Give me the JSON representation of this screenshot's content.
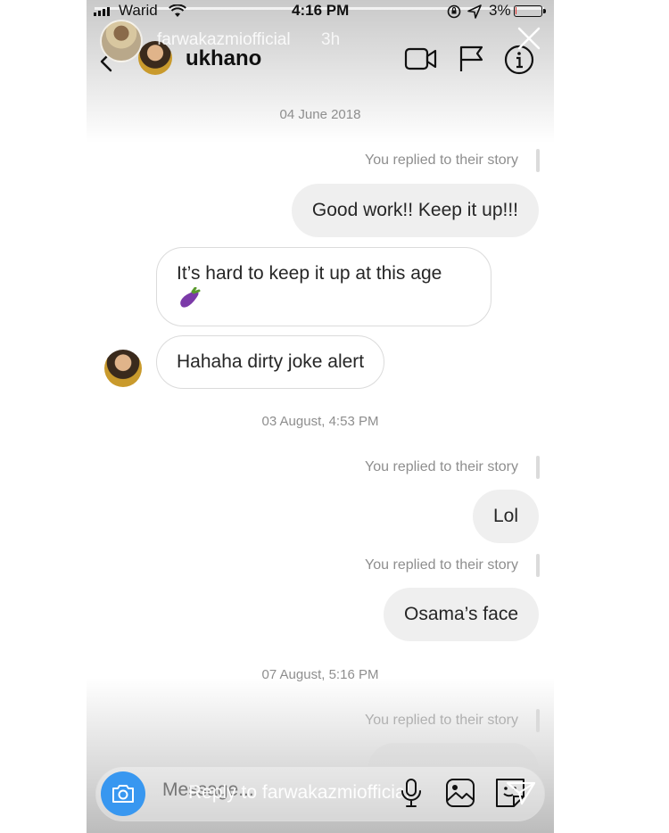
{
  "status_bar": {
    "carrier": "Warid",
    "time": "4:16 PM",
    "battery": "3%",
    "battery_level": 0.03,
    "icons": [
      "signal-icon",
      "wifi-icon",
      "rotation-lock-icon",
      "location-icon",
      "battery-icon"
    ]
  },
  "story": {
    "username": "farwakazmiofficial",
    "age": "3h",
    "reply_placeholder": "Reply to farwakazmiofficial"
  },
  "chat_header": {
    "username": "ukhano",
    "icons": [
      "back-chevron-icon",
      "video-call-icon",
      "flag-icon",
      "info-icon",
      "close-icon"
    ]
  },
  "thread": {
    "timestamps": [
      "04 June 2018",
      "03 August, 4:53 PM",
      "07 August, 5:16 PM"
    ],
    "reply_note": "You replied to their story",
    "messages": [
      {
        "from": "me",
        "text": "Good work!! Keep it up!!!"
      },
      {
        "from": "them",
        "text": "It’s hard to keep it up at this age"
      },
      {
        "from": "them",
        "text": "Hahaha dirty joke alert"
      },
      {
        "from": "me",
        "text": "Lol"
      },
      {
        "from": "me",
        "text": "Osama’s face"
      }
    ],
    "emoji_icon": "eggplant-icon"
  },
  "composer": {
    "placeholder": "Message...",
    "icons": [
      "camera-icon",
      "microphone-icon",
      "gallery-icon",
      "sticker-icon",
      "send-icon"
    ]
  },
  "colors": {
    "accent": "#3897f0",
    "bubble_out": "#efefef",
    "muted_text": "#8e8e8e",
    "battery_low": "#e0302b"
  }
}
